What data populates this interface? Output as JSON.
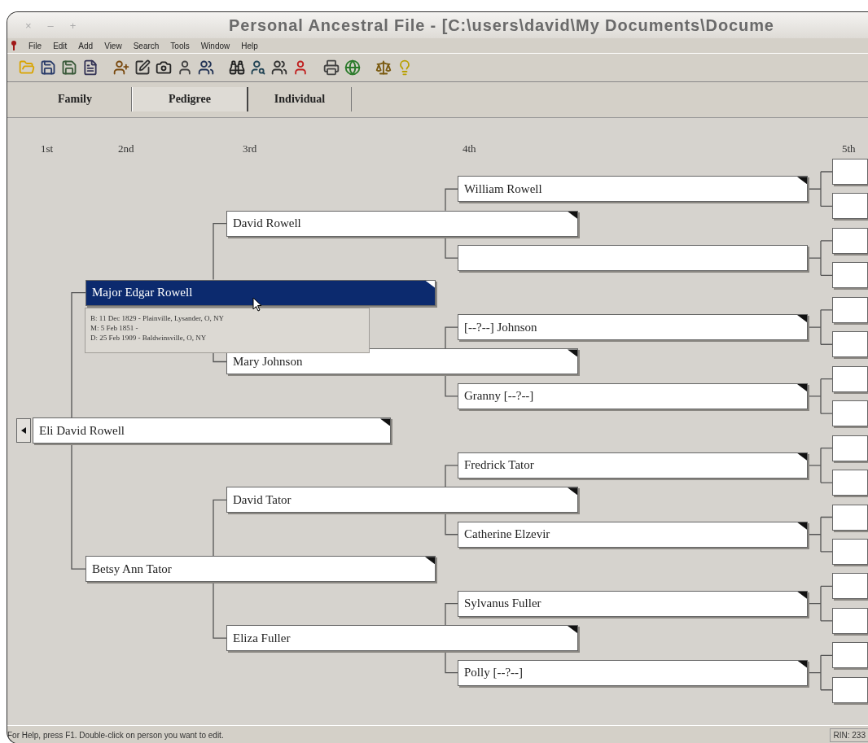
{
  "window": {
    "title": "Personal Ancestral File - [C:\\users\\david\\My Documents\\Docume",
    "controls": [
      "×",
      "–",
      "+"
    ]
  },
  "menu": [
    "File",
    "Edit",
    "Add",
    "View",
    "Search",
    "Tools",
    "Window",
    "Help"
  ],
  "tabs": [
    {
      "label": "Family",
      "selected": false
    },
    {
      "label": "Pedigree",
      "selected": true
    },
    {
      "label": "Individual",
      "selected": false
    }
  ],
  "generations": [
    "1st",
    "2nd",
    "3rd",
    "4th",
    "5th"
  ],
  "pedigree": {
    "name": "Eli David Rowell",
    "selected": false,
    "marked": true,
    "children": [
      {
        "name": "Major Edgar Rowell",
        "selected": true,
        "marked": true,
        "children": [
          {
            "name": "David Rowell",
            "selected": false,
            "marked": true,
            "children": [
              {
                "name": "William Rowell",
                "selected": false,
                "marked": true,
                "children": [
                  {
                    "selected": false,
                    "marked": false
                  },
                  {
                    "selected": false,
                    "marked": false
                  }
                ]
              },
              {
                "selected": false,
                "marked": false,
                "children": [
                  {
                    "selected": false,
                    "marked": false
                  },
                  {
                    "selected": false,
                    "marked": false
                  }
                ]
              }
            ]
          },
          {
            "name": "Mary Johnson",
            "selected": false,
            "marked": true,
            "children": [
              {
                "name": "[--?--] Johnson",
                "selected": false,
                "marked": true,
                "children": [
                  {
                    "selected": false,
                    "marked": false
                  },
                  {
                    "selected": false,
                    "marked": false
                  }
                ]
              },
              {
                "name": "Granny [--?--]",
                "selected": false,
                "marked": true,
                "children": [
                  {
                    "selected": false,
                    "marked": false
                  },
                  {
                    "selected": false,
                    "marked": false
                  }
                ]
              }
            ]
          }
        ]
      },
      {
        "name": "Betsy Ann Tator",
        "selected": false,
        "marked": true,
        "children": [
          {
            "name": "David Tator",
            "selected": false,
            "marked": true,
            "children": [
              {
                "name": "Fredrick Tator",
                "selected": false,
                "marked": true,
                "children": [
                  {
                    "selected": false,
                    "marked": false
                  },
                  {
                    "selected": false,
                    "marked": false
                  }
                ]
              },
              {
                "name": "Catherine Elzevir",
                "selected": false,
                "marked": true,
                "children": [
                  {
                    "selected": false,
                    "marked": false
                  },
                  {
                    "selected": false,
                    "marked": false
                  }
                ]
              }
            ]
          },
          {
            "name": "Eliza Fuller",
            "selected": false,
            "marked": true,
            "children": [
              {
                "name": "Sylvanus Fuller",
                "selected": false,
                "marked": true,
                "children": [
                  {
                    "selected": false,
                    "marked": false
                  },
                  {
                    "selected": false,
                    "marked": false
                  }
                ]
              },
              {
                "name": "Polly [--?--]",
                "selected": false,
                "marked": true,
                "children": [
                  {
                    "selected": false,
                    "marked": false
                  },
                  {
                    "selected": false,
                    "marked": false
                  }
                ]
              }
            ]
          }
        ]
      }
    ]
  },
  "tooltip": {
    "lines": [
      "B: 11 Dec 1829 - Plainville, Lysander, O, NY",
      "M: 5 Feb 1851 -",
      "D: 25 Feb 1909 - Baldwinsville, O, NY"
    ]
  },
  "status_bar": {
    "message": "For Help, press F1. Double-click on person you want to edit.",
    "rin": "RIN: 233"
  }
}
